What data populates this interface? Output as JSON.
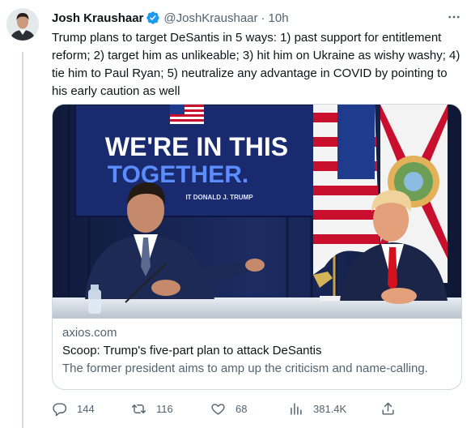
{
  "tweet": {
    "author_name": "Josh Kraushaar",
    "handle": "@JoshKraushaar",
    "separator": "·",
    "time": "10h",
    "more_label": "···",
    "text": "Trump plans to target DeSantis in 5 ways: 1) past support for entitlement reform; 2) target him as unlikeable; 3) hit him on Ukraine as wishy washy; 4) tie him to Paul Ryan; 5) neutralize any advantage in COVID by pointing to his early caution as well"
  },
  "card": {
    "image": {
      "banner_line1": "WE'RE IN THIS",
      "banner_line2": "TOGETHER.",
      "banner_small": "IT DONALD J. TRUMP"
    },
    "domain": "axios.com",
    "title": "Scoop: Trump's five-part plan to attack DeSantis",
    "description": "The former president aims to amp up the criticism and name-calling."
  },
  "actions": {
    "replies": "144",
    "retweets": "116",
    "likes": "68",
    "views": "381.4K"
  },
  "colors": {
    "verified": "#1d9bf0",
    "text_primary": "#0f1419",
    "text_secondary": "#536471",
    "border": "#cfd9de"
  }
}
